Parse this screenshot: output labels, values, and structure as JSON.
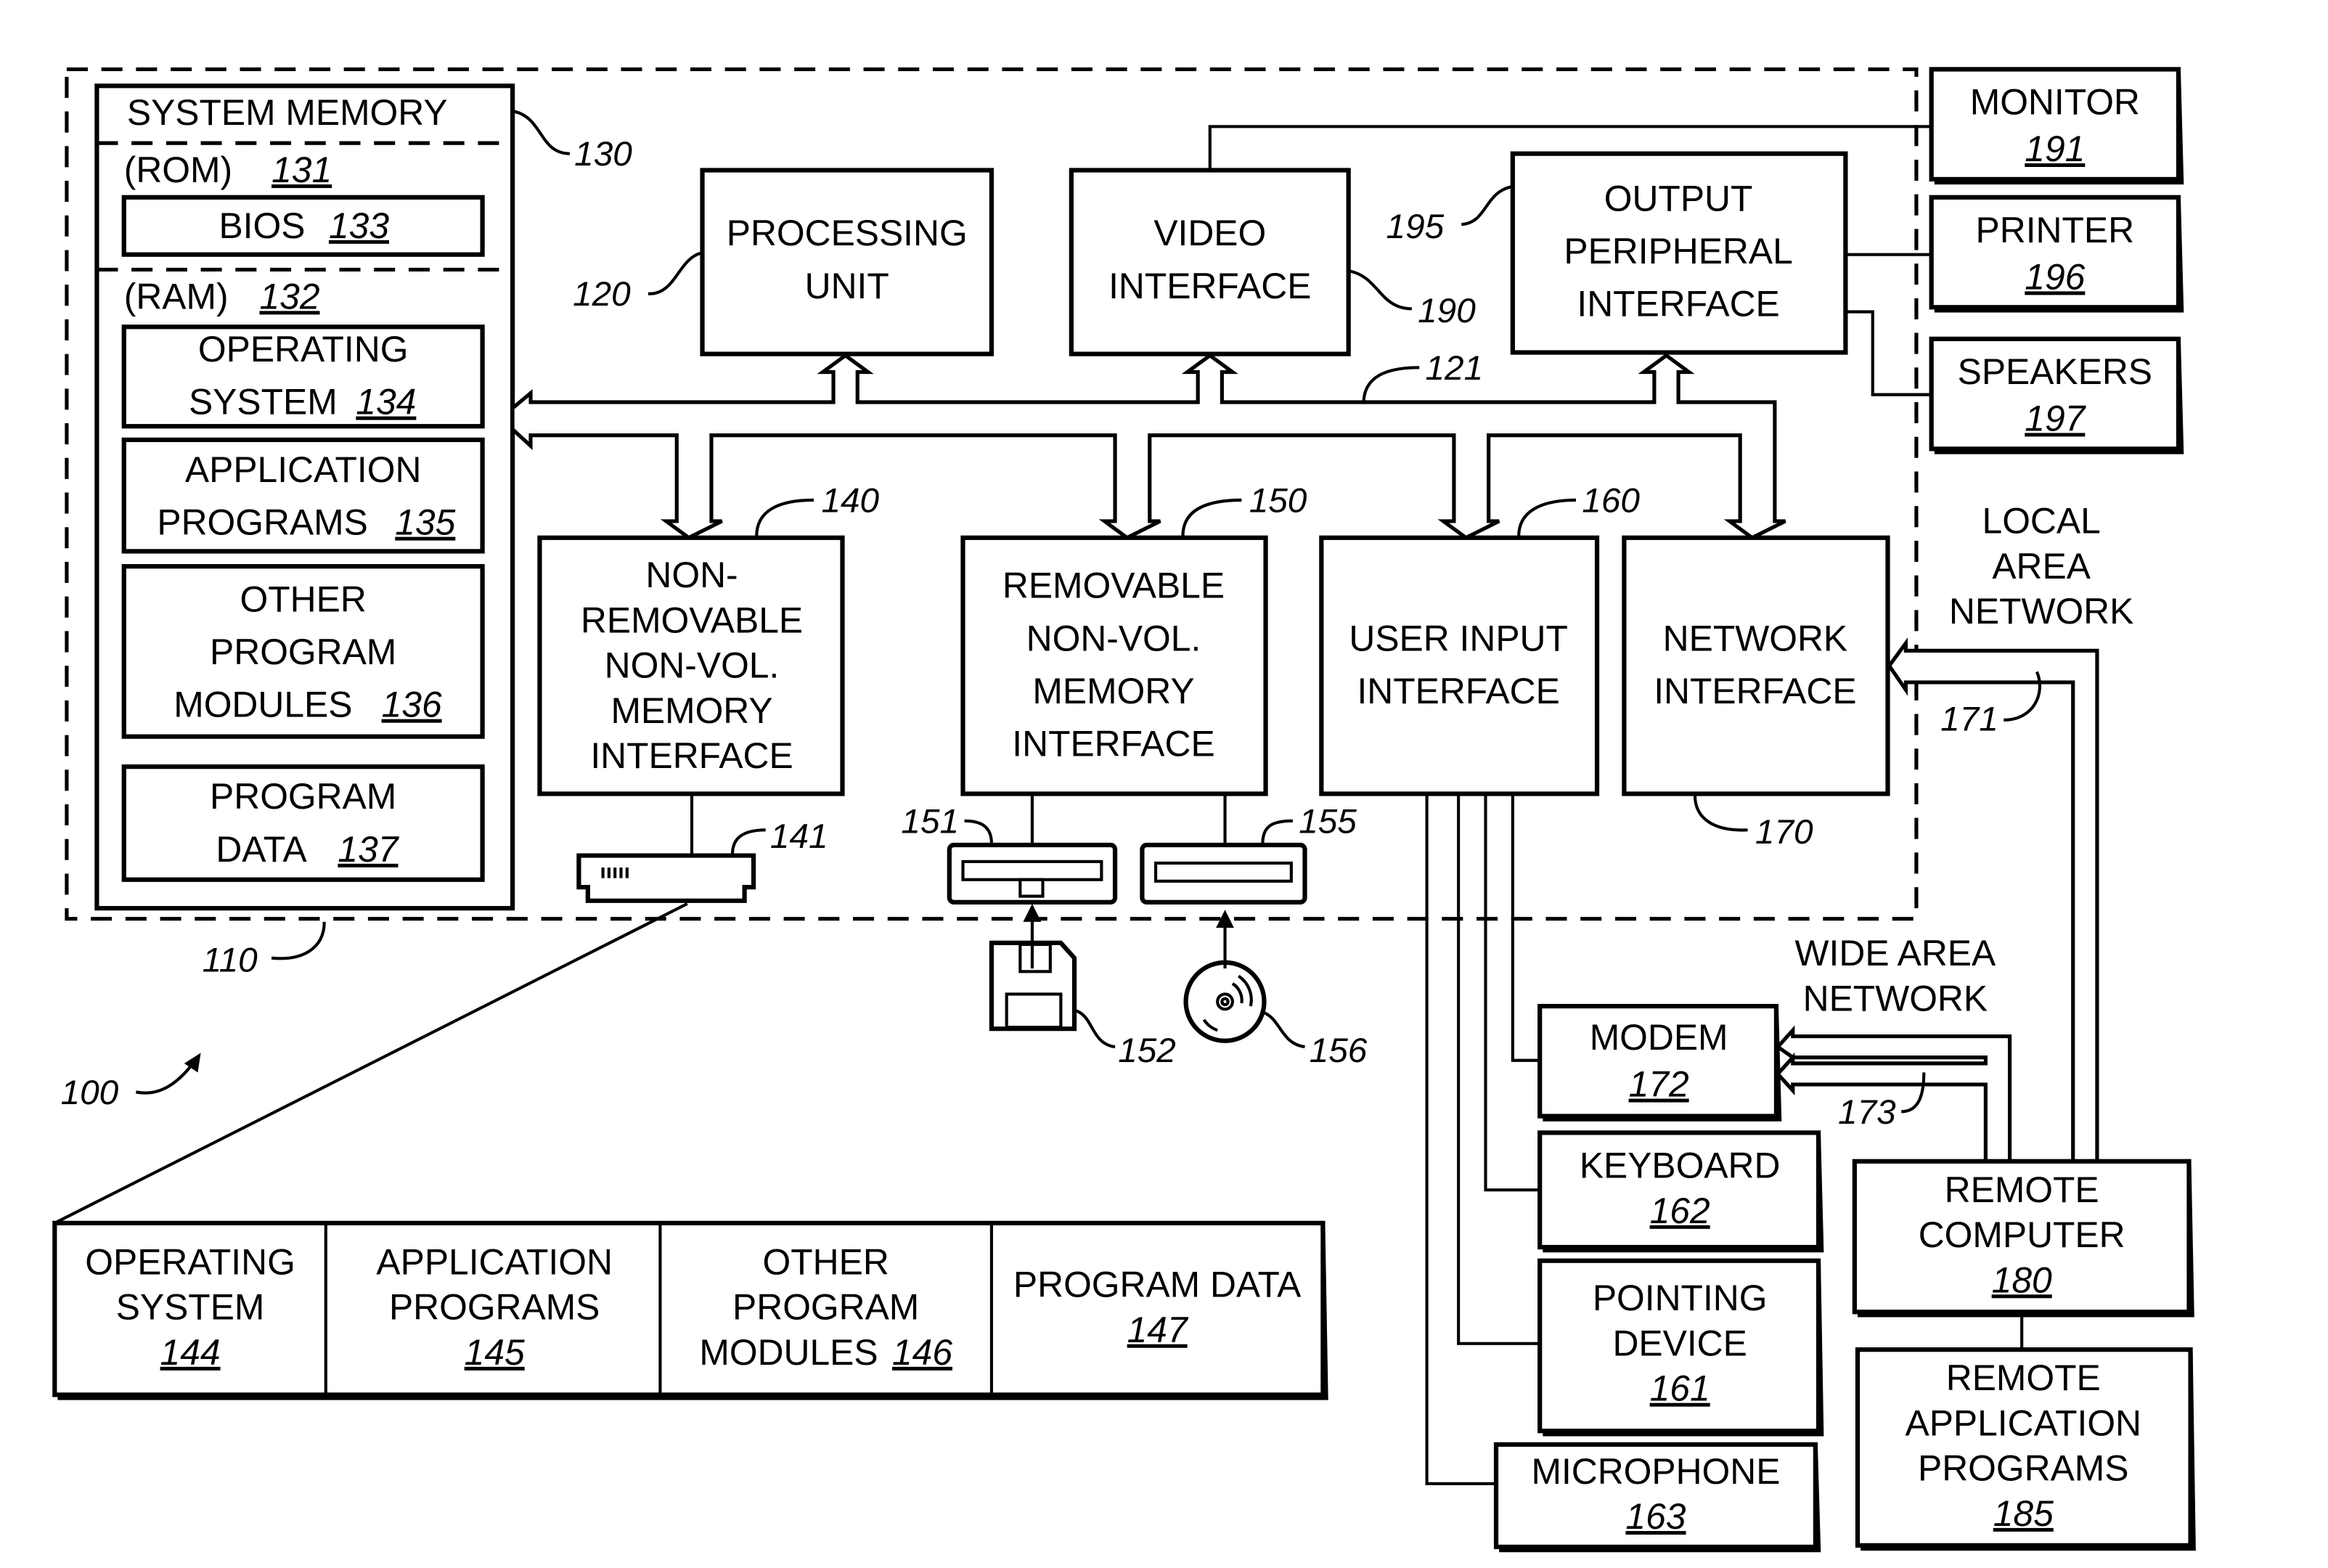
{
  "figure_label": "100",
  "computer": {
    "ref": "110"
  },
  "system_memory": {
    "title": "SYSTEM MEMORY",
    "ref": "130",
    "rom": {
      "label": "(ROM)",
      "ref": "131"
    },
    "bios": {
      "label": "BIOS",
      "ref": "133"
    },
    "ram": {
      "label": "(RAM)",
      "ref": "132"
    },
    "items": [
      {
        "line1": "OPERATING",
        "line2": "SYSTEM",
        "ref": "134"
      },
      {
        "line1": "APPLICATION",
        "line2": "PROGRAMS",
        "ref": "135"
      },
      {
        "line1": "OTHER",
        "line2": "PROGRAM",
        "line3": "MODULES",
        "ref": "136"
      },
      {
        "line1": "PROGRAM",
        "line2": "DATA",
        "ref": "137"
      }
    ]
  },
  "processing_unit": {
    "line1": "PROCESSING",
    "line2": "UNIT",
    "ref": "120"
  },
  "video_interface": {
    "line1": "VIDEO",
    "line2": "INTERFACE",
    "ref": "190"
  },
  "output_peripheral_interface": {
    "line1": "OUTPUT",
    "line2": "PERIPHERAL",
    "line3": "INTERFACE",
    "ref": "195"
  },
  "system_bus": {
    "ref": "121"
  },
  "monitor": {
    "label": "MONITOR",
    "ref": "191"
  },
  "printer": {
    "label": "PRINTER",
    "ref": "196"
  },
  "speakers": {
    "label": "SPEAKERS",
    "ref": "197"
  },
  "nonremovable_interface": {
    "lines": [
      "NON-",
      "REMOVABLE",
      "NON-VOL.",
      "MEMORY",
      "INTERFACE"
    ],
    "ref": "140"
  },
  "removable_interface": {
    "lines": [
      "REMOVABLE",
      "NON-VOL.",
      "MEMORY",
      "INTERFACE"
    ],
    "ref": "150"
  },
  "user_input_interface": {
    "line1": "USER INPUT",
    "line2": "INTERFACE",
    "ref": "160"
  },
  "network_interface": {
    "line1": "NETWORK",
    "line2": "INTERFACE",
    "ref": "170"
  },
  "hard_disk": {
    "ref": "141"
  },
  "floppy_drive": {
    "ref": "151"
  },
  "optical_drive": {
    "ref": "155"
  },
  "floppy_disk": {
    "ref": "152"
  },
  "optical_disk": {
    "ref": "156"
  },
  "lan": {
    "line1": "LOCAL",
    "line2": "AREA",
    "line3": "NETWORK",
    "ref": "171"
  },
  "wan": {
    "line1": "WIDE AREA",
    "line2": "NETWORK",
    "ref": "173"
  },
  "modem": {
    "label": "MODEM",
    "ref": "172"
  },
  "keyboard": {
    "label": "KEYBOARD",
    "ref": "162"
  },
  "pointing_device": {
    "line1": "POINTING",
    "line2": "DEVICE",
    "ref": "161"
  },
  "microphone": {
    "label": "MICROPHONE",
    "ref": "163"
  },
  "remote_computer": {
    "line1": "REMOTE",
    "line2": "COMPUTER",
    "ref": "180"
  },
  "remote_apps": {
    "line1": "REMOTE",
    "line2": "APPLICATION",
    "line3": "PROGRAMS",
    "ref": "185"
  },
  "disk_contents": [
    {
      "line1": "OPERATING",
      "line2": "SYSTEM",
      "ref": "144"
    },
    {
      "line1": "APPLICATION",
      "line2": "PROGRAMS",
      "ref": "145"
    },
    {
      "line1": "OTHER",
      "line2": "PROGRAM",
      "line3": "MODULES",
      "ref": "146"
    },
    {
      "line1": "PROGRAM DATA",
      "ref": "147"
    }
  ]
}
